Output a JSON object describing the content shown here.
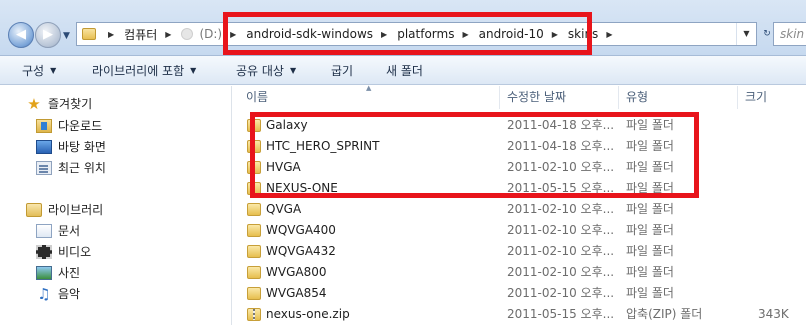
{
  "address_bar": {
    "path": [
      {
        "label": "컴퓨터"
      },
      {
        "label": "(D:)"
      },
      {
        "label": "android-sdk-windows"
      },
      {
        "label": "platforms"
      },
      {
        "label": "android-10"
      },
      {
        "label": "skins"
      }
    ],
    "search_text": "skin"
  },
  "toolbar": {
    "organize": "구성",
    "library": "라이브러리에 포함",
    "share": "공유 대상",
    "burn": "굽기",
    "new_folder": "새 폴더"
  },
  "nav": {
    "favorites": {
      "label": "즐겨찾기",
      "items": [
        {
          "label": "다운로드",
          "icon": "download-folder-icon"
        },
        {
          "label": "바탕 화면",
          "icon": "desktop-icon"
        },
        {
          "label": "최근 위치",
          "icon": "recent-places-icon"
        }
      ]
    },
    "libraries": {
      "label": "라이브러리",
      "items": [
        {
          "label": "문서",
          "icon": "documents-icon"
        },
        {
          "label": "비디오",
          "icon": "videos-icon"
        },
        {
          "label": "사진",
          "icon": "pictures-icon"
        },
        {
          "label": "음악",
          "icon": "music-icon"
        }
      ]
    }
  },
  "columns": {
    "name": "이름",
    "date": "수정한 날짜",
    "type": "유형",
    "size": "크기"
  },
  "files": [
    {
      "name": "Galaxy",
      "date": "2011-04-18 오후...",
      "type": "파일 폴더",
      "size": "",
      "kind": "folder"
    },
    {
      "name": "HTC_HERO_SPRINT",
      "date": "2011-04-18 오후...",
      "type": "파일 폴더",
      "size": "",
      "kind": "folder"
    },
    {
      "name": "HVGA",
      "date": "2011-02-10 오후...",
      "type": "파일 폴더",
      "size": "",
      "kind": "folder"
    },
    {
      "name": "NEXUS-ONE",
      "date": "2011-05-15 오후...",
      "type": "파일 폴더",
      "size": "",
      "kind": "folder"
    },
    {
      "name": "QVGA",
      "date": "2011-02-10 오후...",
      "type": "파일 폴더",
      "size": "",
      "kind": "folder"
    },
    {
      "name": "WQVGA400",
      "date": "2011-02-10 오후...",
      "type": "파일 폴더",
      "size": "",
      "kind": "folder"
    },
    {
      "name": "WQVGA432",
      "date": "2011-02-10 오후...",
      "type": "파일 폴더",
      "size": "",
      "kind": "folder"
    },
    {
      "name": "WVGA800",
      "date": "2011-02-10 오후...",
      "type": "파일 폴더",
      "size": "",
      "kind": "folder"
    },
    {
      "name": "WVGA854",
      "date": "2011-02-10 오후...",
      "type": "파일 폴더",
      "size": "",
      "kind": "folder"
    },
    {
      "name": "nexus-one.zip",
      "date": "2011-05-15 오후...",
      "type": "압축(ZIP) 폴더",
      "size": "343K",
      "kind": "zip"
    }
  ],
  "annotation_color": "#e8141b"
}
